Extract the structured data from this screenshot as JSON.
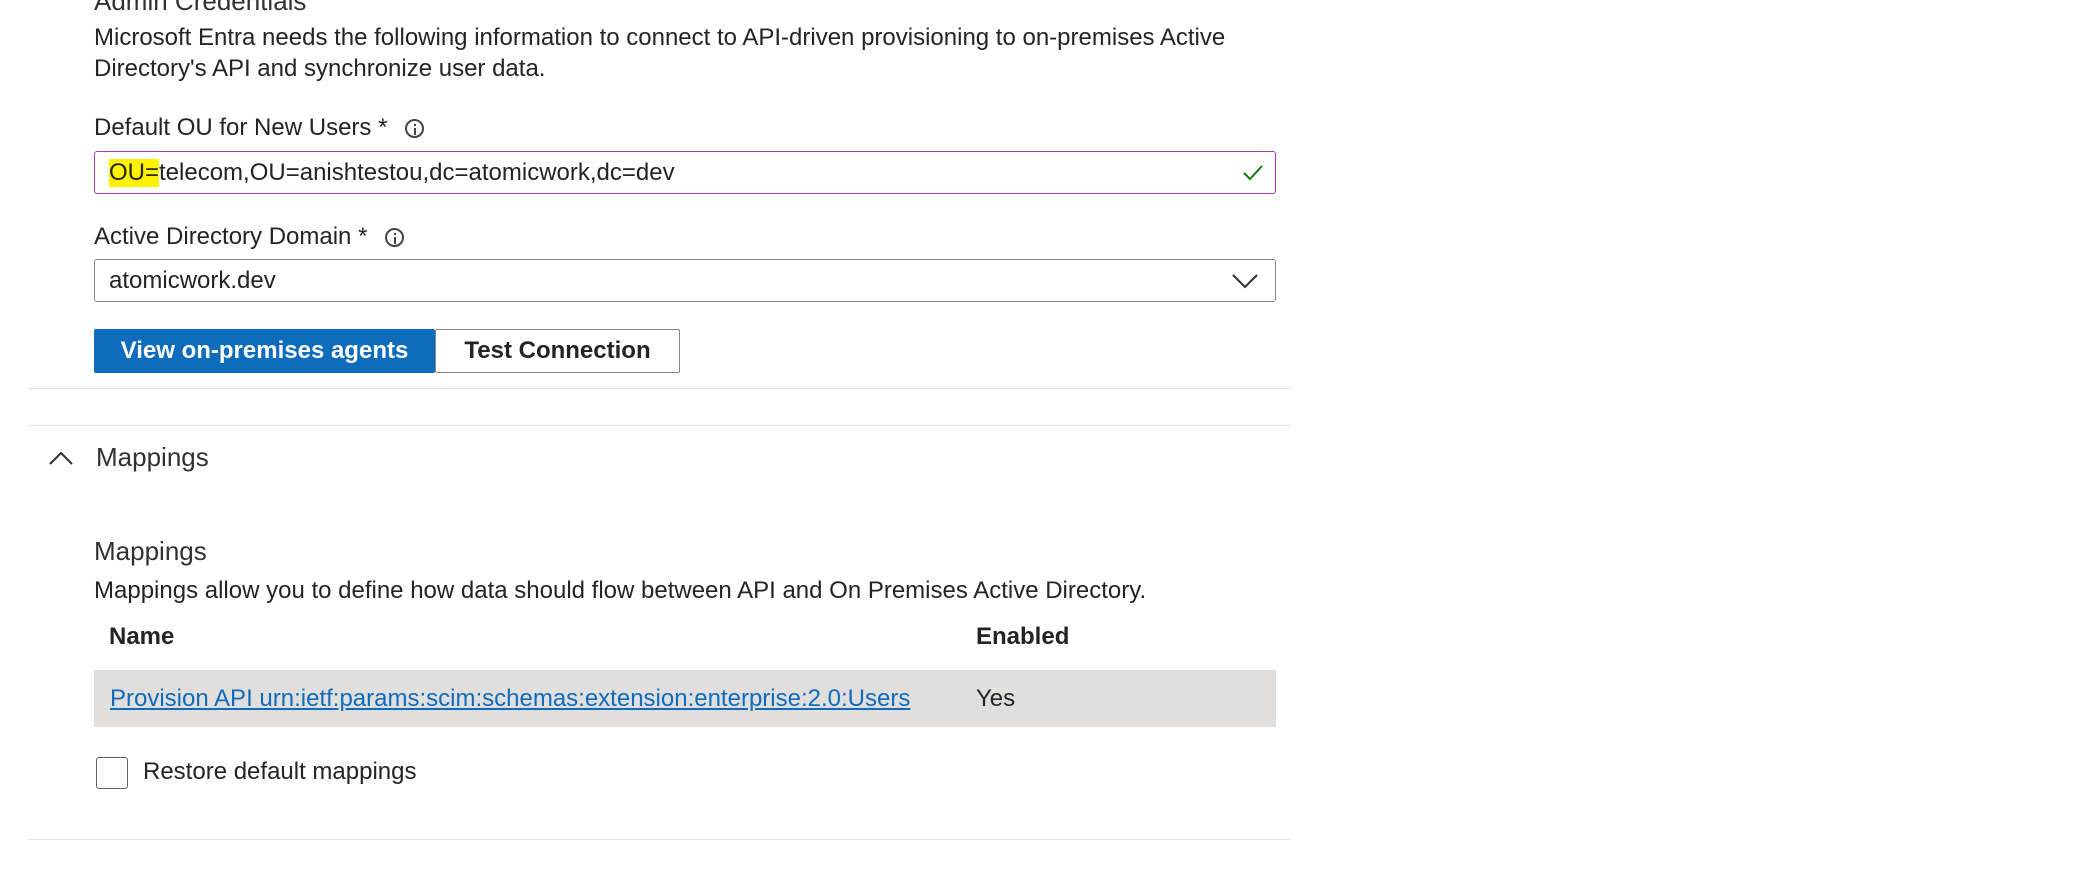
{
  "admin": {
    "section_title": "Admin Credentials",
    "description": "Microsoft Entra needs the following information to connect to API-driven provisioning to on-premises Active Directory's API and synchronize user data."
  },
  "default_ou": {
    "label": "Default OU for New Users *",
    "value_highlight": "OU=",
    "value_rest": "telecom,OU=anishtestou,dc=atomicwork,dc=dev",
    "valid_icon": "checkmark-icon",
    "border_color": "#a23fb5",
    "highlight_color": "#fff200"
  },
  "ad_domain": {
    "label": "Active Directory Domain *",
    "selected": "atomicwork.dev"
  },
  "buttons": {
    "view_agents": "View on-premises agents",
    "test_connection": "Test Connection"
  },
  "mappings_section": {
    "header": "Mappings",
    "sub_title": "Mappings",
    "description": "Mappings allow you to define how data should flow between API and On Premises Active Directory.",
    "columns": [
      "Name",
      "Enabled"
    ],
    "rows": [
      {
        "name": "Provision API urn:ietf:params:scim:schemas:extension:enterprise:2.0:Users",
        "enabled": "Yes"
      }
    ],
    "restore_label": "Restore default mappings",
    "restore_checked": false
  },
  "colors": {
    "accent": "#0f6cbd",
    "row_highlight": "#e1dfdd",
    "check_green": "#107c10"
  }
}
